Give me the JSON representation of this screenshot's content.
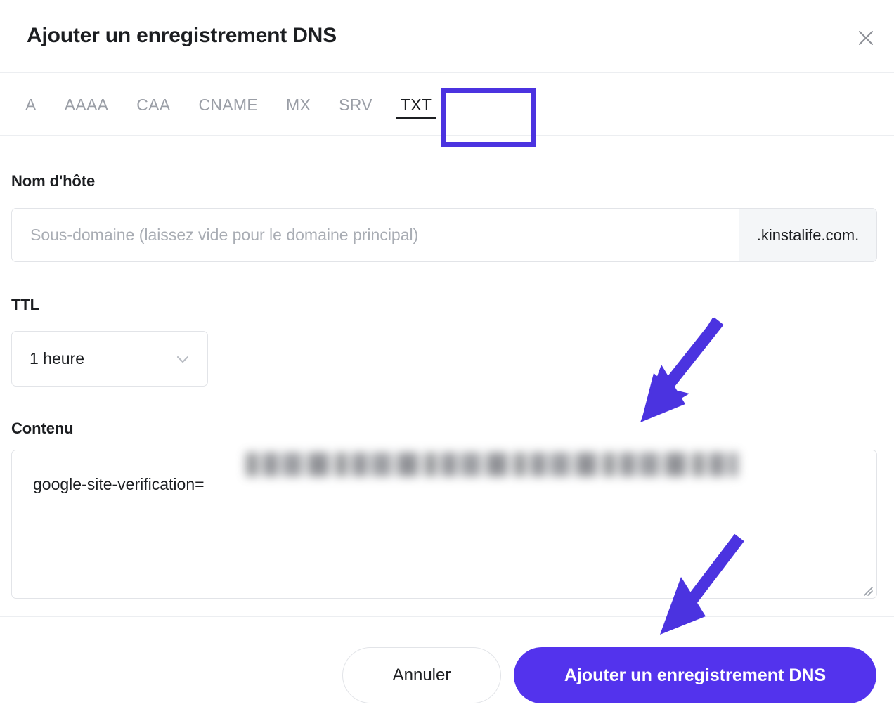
{
  "dialog": {
    "title": "Ajouter un enregistrement DNS",
    "close_icon": "close-icon"
  },
  "tabs": {
    "items": [
      {
        "label": "A",
        "active": false
      },
      {
        "label": "AAAA",
        "active": false
      },
      {
        "label": "CAA",
        "active": false
      },
      {
        "label": "CNAME",
        "active": false
      },
      {
        "label": "MX",
        "active": false
      },
      {
        "label": "SRV",
        "active": false
      },
      {
        "label": "TXT",
        "active": true
      }
    ],
    "highlighted": "TXT"
  },
  "form": {
    "hostname": {
      "label": "Nom d'hôte",
      "placeholder": "Sous-domaine (laissez vide pour le domaine principal)",
      "value": "",
      "suffix": ".kinstalife.com."
    },
    "ttl": {
      "label": "TTL",
      "value": "1 heure",
      "chevron_icon": "chevron-down-icon"
    },
    "content": {
      "label": "Contenu",
      "value": "google-site-verification=",
      "redacted": true
    }
  },
  "footer": {
    "cancel_label": "Annuler",
    "submit_label": "Ajouter un enregistrement DNS"
  },
  "annotations": {
    "accent_color": "#4B33E0",
    "primary_button_color": "#5333ED",
    "arrows": [
      {
        "name": "arrow-to-content-field"
      },
      {
        "name": "arrow-to-submit-button"
      }
    ]
  }
}
